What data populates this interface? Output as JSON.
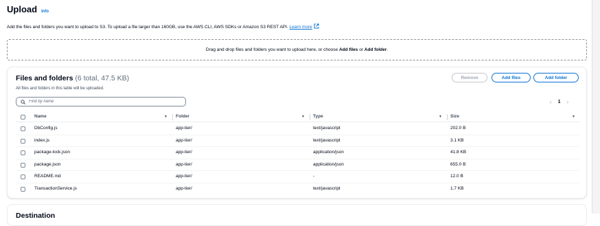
{
  "header": {
    "title": "Upload",
    "info": "Info",
    "description": "Add the files and folders you want to upload to S3. To upload a file larger than 160GB, use the AWS CLI, AWS SDKs or Amazon S3 REST API.",
    "learn_more": "Learn more"
  },
  "dropzone": {
    "prefix": "Drag and drop files and folders you want to upload here, or choose",
    "add_files": "Add files",
    "or": "or",
    "add_folder": "Add folder",
    "suffix": "."
  },
  "files_panel": {
    "title": "Files and folders",
    "counter": "(6 total, 47.5 KB)",
    "subtitle": "All files and folders in this table will be uploaded.",
    "remove_label": "Remove",
    "add_files_label": "Add files",
    "add_folder_label": "Add folder",
    "search_placeholder": "Find by name",
    "pagination": {
      "current_page": "1",
      "prev": "‹",
      "next": "›"
    },
    "columns": [
      "Name",
      "Folder",
      "Type",
      "Size"
    ],
    "rows": [
      {
        "name": "DbConfig.js",
        "folder": "app-tier/",
        "type": "text/javascript",
        "size": "202.0 B"
      },
      {
        "name": "index.js",
        "folder": "app-tier/",
        "type": "text/javascript",
        "size": "3.1 KB"
      },
      {
        "name": "package-lock.json",
        "folder": "app-tier/",
        "type": "application/json",
        "size": "41.8 KB"
      },
      {
        "name": "package.json",
        "folder": "app-tier/",
        "type": "application/json",
        "size": "655.0 B"
      },
      {
        "name": "README.md",
        "folder": "app-tier/",
        "type": "-",
        "size": "12.0 B"
      },
      {
        "name": "TransactionService.js",
        "folder": "app-tier/",
        "type": "text/javascript",
        "size": "1.7 KB"
      }
    ]
  },
  "next_panel": {
    "title": "Destination"
  },
  "colors": {
    "link": "#0972d3",
    "text": "#000716",
    "muted": "#5f6b7a",
    "border": "#e9ebed"
  },
  "icons": [
    "external-link-icon",
    "search-icon",
    "sort-caret-icon",
    "checkbox-icon"
  ]
}
